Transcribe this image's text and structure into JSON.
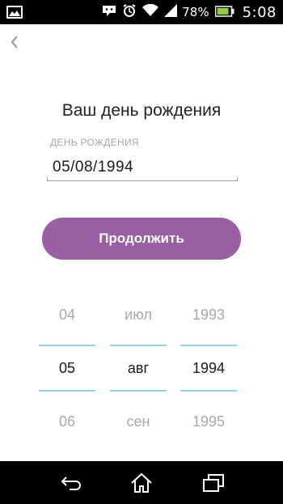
{
  "status_bar": {
    "battery_percent": "78%",
    "time": "5:08",
    "icons": [
      "gallery-icon",
      "messenger-icon",
      "alarm-icon",
      "wifi-icon",
      "signal-icon",
      "battery-icon"
    ]
  },
  "header": {
    "back_icon": "chevron-left-icon"
  },
  "title": "Ваш день рождения",
  "birthday_field": {
    "label": "ДЕНЬ РОЖДЕНИЯ",
    "value": "05/08/1994"
  },
  "continue_button": {
    "label": "Продолжить",
    "color": "#9a5ea3"
  },
  "date_picker": {
    "day": {
      "previous": "04",
      "selected": "05",
      "next": "06"
    },
    "month": {
      "previous": "июл",
      "selected": "авг",
      "next": "сен"
    },
    "year": {
      "previous": "1993",
      "selected": "1994",
      "next": "1995"
    },
    "divider_color": "#8fd3f0"
  },
  "nav_bar": {
    "icons": [
      "back-nav-icon",
      "home-nav-icon",
      "recent-apps-icon"
    ]
  }
}
